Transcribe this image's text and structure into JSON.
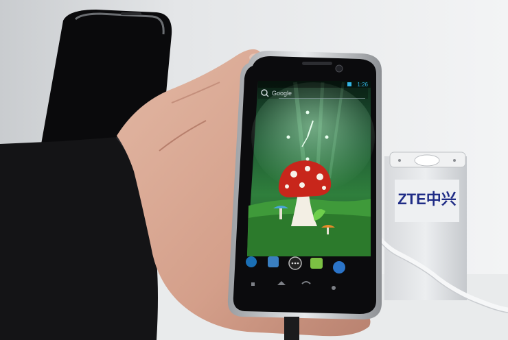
{
  "phone_screen": {
    "search_text": "Google",
    "clock_time": "1:26"
  },
  "display_stand": {
    "brand_text": "ZTE中兴"
  },
  "colors": {
    "wallpaper_green": "#2e6b3a",
    "mushroom_red": "#c8261b",
    "stand_white": "#e9eaec",
    "jacket_black": "#141416"
  }
}
